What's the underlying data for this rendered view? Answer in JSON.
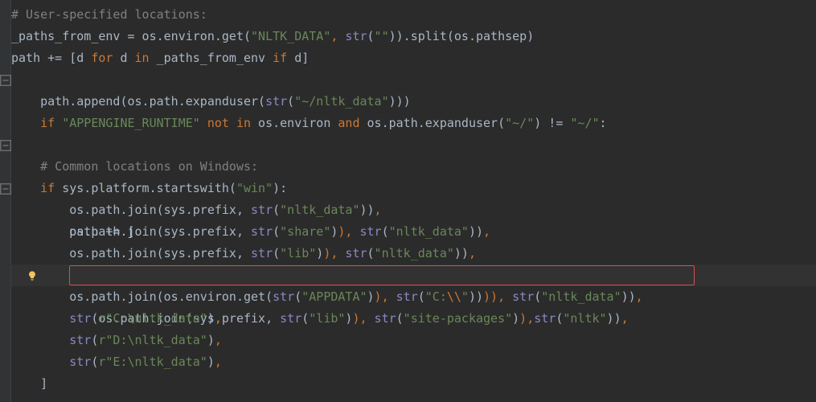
{
  "editor": {
    "lines": {
      "l1_comment": "# User-specified locations:",
      "l2_a": "_paths_from_env = os.environ.get(",
      "l2_s1": "\"NLTK_DATA\"",
      "l2_b": ", ",
      "l2_s2": "\"\"",
      "l2_c": ").split(os.pathsep)",
      "l3_a": "path += [d ",
      "l3_for": "for",
      "l3_b": " d ",
      "l3_in": "in",
      "l3_c": " _paths_from_env ",
      "l3_if": "if",
      "l3_d": " d]",
      "l4_if": "if",
      "l4_a": " ",
      "l4_s1": "\"APPENGINE_RUNTIME\"",
      "l4_b": " ",
      "l4_not": "not in",
      "l4_c": " os.environ ",
      "l4_and": "and",
      "l4_d": " os.path.expanduser(",
      "l4_s2": "\"~/\"",
      "l4_e": ") != ",
      "l4_s3": "\"~/\"",
      "l4_f": ":",
      "l5_a": "    path.append(os.path.expanduser(",
      "l5_str": "str",
      "l5_b": "(",
      "l5_s1": "\"~/nltk_data\"",
      "l5_c": ")))",
      "l7_if": "if",
      "l7_a": " sys.platform.startswith(",
      "l7_s1": "\"win\"",
      "l7_b": "):",
      "l8_comment": "    # Common locations on Windows:",
      "l9_a": "    path += [",
      "l10_a": "        os.path.join(sys.prefix, ",
      "l10_str": "str",
      "l10_b": "(",
      "l10_s1": "\"nltk_data\"",
      "l10_c": ")),",
      "l11_a": "        os.path.join(sys.prefix, ",
      "l11_str": "str",
      "l11_b": "(",
      "l11_s1": "\"share\"",
      "l11_c": "), ",
      "l11_str2": "str",
      "l11_d": "(",
      "l11_s2": "\"nltk_data\"",
      "l11_e": ")),",
      "l12_a": "        os.path.join(sys.prefix, ",
      "l12_str": "str",
      "l12_b": "(",
      "l12_s1": "\"lib\"",
      "l12_c": "), ",
      "l12_str2": "str",
      "l12_d": "(",
      "l12_s2": "\"nltk_data\"",
      "l12_e": ")),",
      "l13_a": "        os.path.join(sys.prefix, ",
      "l13_str": "str",
      "l13_b": "(",
      "l13_s1": "\"lib\"",
      "l13_c": "), ",
      "l13_str2": "str",
      "l13_d": "(",
      "l13_s2": "\"site-packages\"",
      "l13_e": "),",
      "l13_str3": "str",
      "l13_f": "(",
      "l13_s3": "\"nltk\"",
      "l13_g": ")),",
      "l14_a": "        os.path.join(os.environ.get(",
      "l14_str": "str",
      "l14_b": "(",
      "l14_s1": "\"APPDATA\"",
      "l14_c": "), ",
      "l14_str2": "str",
      "l14_d": "(",
      "l14_s2": "\"C:",
      "l14_esc": "\\\\",
      "l14_s2b": "\"",
      "l14_e": ")), ",
      "l14_str3": "str",
      "l14_f": "(",
      "l14_s3": "\"nltk_data\"",
      "l14_g": ")),",
      "l15_a": "        ",
      "l15_str": "str",
      "l15_b": "(",
      "l15_r": "r",
      "l15_s1": "\"C:\\nltk_data\"",
      "l15_c": "),",
      "l16_a": "        ",
      "l16_str": "str",
      "l16_b": "(",
      "l16_r": "r",
      "l16_s1": "\"D:\\nltk_data\"",
      "l16_c": "),",
      "l17_a": "        ",
      "l17_str": "str",
      "l17_b": "(",
      "l17_r": "r",
      "l17_s1": "\"E:\\nltk_data\"",
      "l17_c": "),",
      "l18_a": "    ]"
    }
  },
  "icons": {
    "bulb": "bulb-icon",
    "fold_minus": "fold-minus-icon"
  },
  "colors": {
    "bg": "#2b2b2b",
    "gutter": "#313335",
    "text": "#a9b7c6",
    "keyword": "#cc7832",
    "string": "#6a8759",
    "comment": "#808080",
    "builtin": "#8888c6",
    "highlight_box": "#d64d4d",
    "bulb": "#f2c55c"
  }
}
